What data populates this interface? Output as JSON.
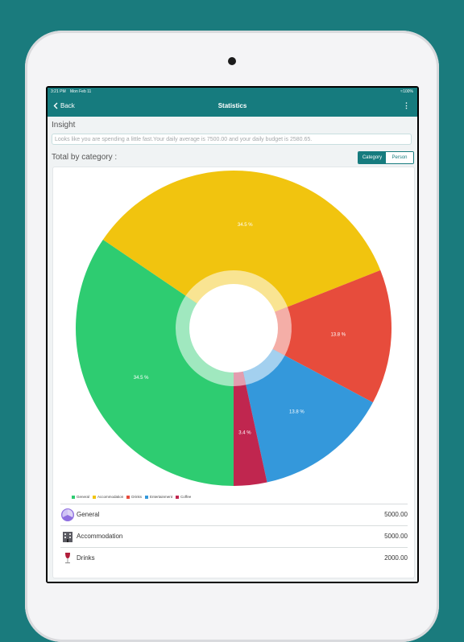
{
  "status_bar": {
    "time": "3:21 PM",
    "date": "Mon Feb 11",
    "battery": "100%"
  },
  "nav": {
    "back_label": "Back",
    "title": "Statistics",
    "more_icon": "more-vertical-icon"
  },
  "insight": {
    "heading": "Insight",
    "text": "Looks like you are spending a little fast.Your daily average is 7500.00 and your daily budget is 2580.65."
  },
  "total": {
    "heading": "Total by category :"
  },
  "segmented": {
    "category": "Category",
    "person": "Person",
    "selected": "Category"
  },
  "chart_data": {
    "type": "pie",
    "style": "donut",
    "categories": [
      "General",
      "Accommodation",
      "Drinks",
      "Entertainment",
      "Coffee"
    ],
    "values": [
      34.5,
      34.5,
      13.8,
      13.8,
      3.4
    ],
    "labels": [
      "34.5 %",
      "34.5 %",
      "13.8 %",
      "13.8 %",
      "3.4 %"
    ],
    "colors": [
      "#2ecc71",
      "#f1c40f",
      "#e74c3c",
      "#3498db",
      "#c0264f"
    ],
    "legend": "bottom-left"
  },
  "list": [
    {
      "name": "General",
      "amount": "5000.00",
      "icon": "general-category-icon"
    },
    {
      "name": "Accommodation",
      "amount": "5000.00",
      "icon": "accommodation-building-icon"
    },
    {
      "name": "Drinks",
      "amount": "2000.00",
      "icon": "wine-glass-icon"
    }
  ]
}
